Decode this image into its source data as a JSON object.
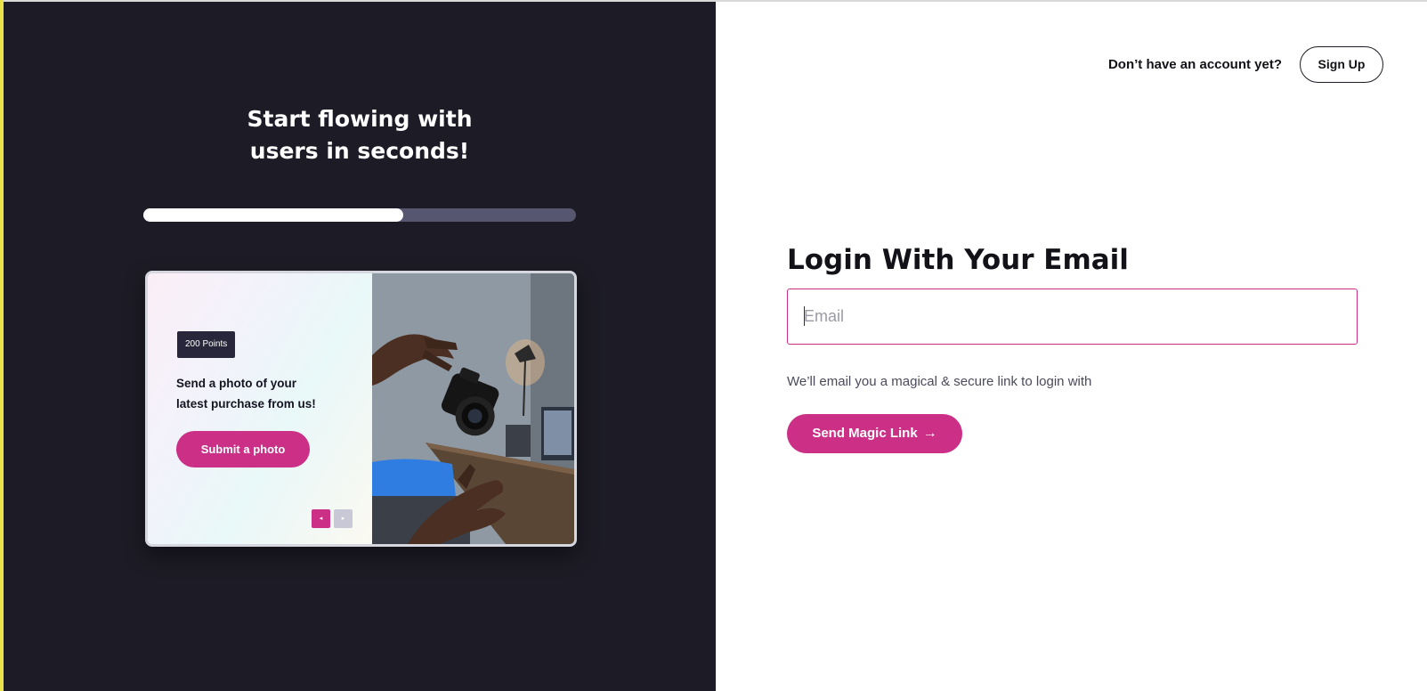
{
  "colors": {
    "dark_panel": "#1d1c26",
    "accent": "#cb2f86",
    "progress_track": "#565670",
    "badge": "#27263a"
  },
  "onboarding": {
    "title": "Start flowing with\nusers in seconds!",
    "progress_fraction": 0.6
  },
  "card": {
    "badge": "200 Points",
    "text": "Send a photo of your\nlatest purchase from us!",
    "button_label": "Submit a photo",
    "prev_icon": "◂",
    "next_icon": "▸",
    "photo": "camera-being-tossed-between-hands-photo"
  },
  "header": {
    "prompt": "Don’t have an account yet?",
    "signup_label": "Sign Up"
  },
  "login": {
    "title": "Login With Your Email",
    "email_placeholder": "Email",
    "email_value": "",
    "helper": "We’ll email you a magical & secure link to login with",
    "button_label": "Send Magic Link",
    "button_icon": "→"
  }
}
